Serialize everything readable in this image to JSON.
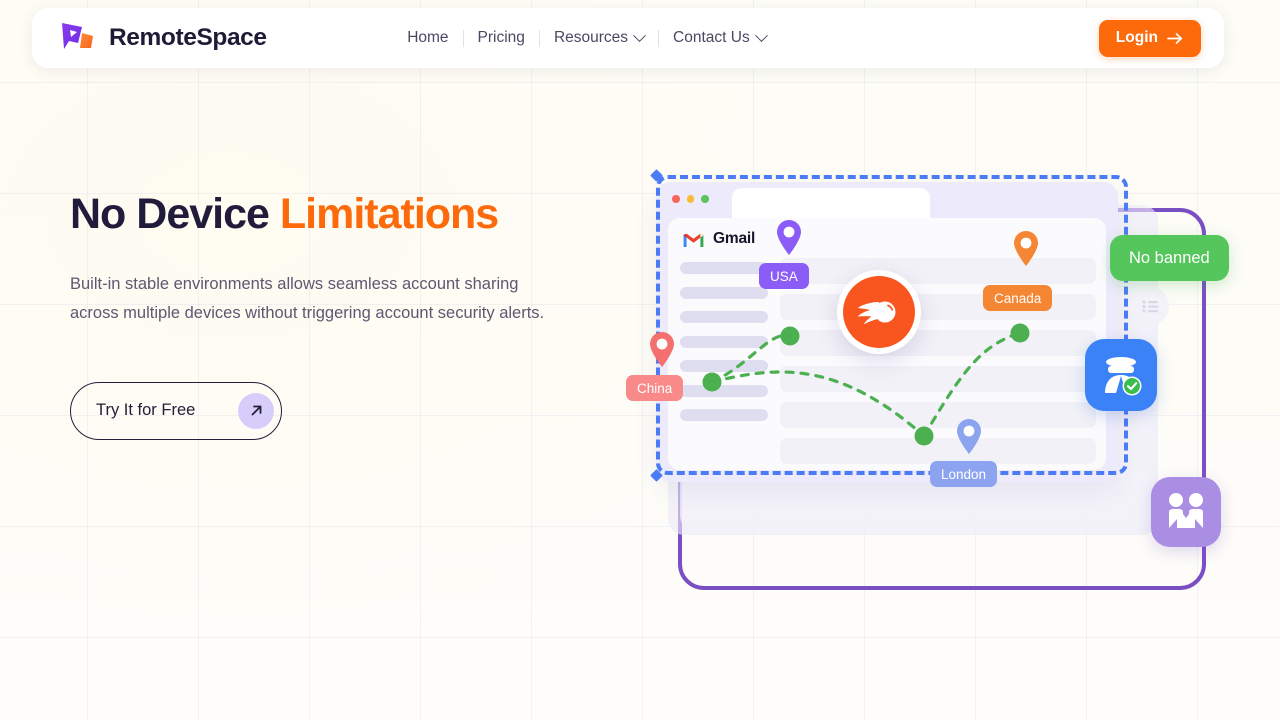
{
  "brand": {
    "name": "RemoteSpace",
    "logo_icon": "cursor-arrow-logo"
  },
  "nav": {
    "items": [
      {
        "label": "Home",
        "has_dropdown": false
      },
      {
        "label": "Pricing",
        "has_dropdown": false
      },
      {
        "label": "Resources",
        "has_dropdown": true
      },
      {
        "label": "Contact Us",
        "has_dropdown": true
      }
    ],
    "login": {
      "label": "Login",
      "icon": "arrow-right-icon",
      "color": "#fc6a0c"
    }
  },
  "hero": {
    "headline_primary": "No Device ",
    "headline_accent": "Limitations",
    "subtitle": "Built-in stable environments allows seamless account sharing across multiple devices without triggering account security alerts.",
    "cta": {
      "label": "Try It for Free",
      "icon": "arrow-up-right-icon"
    }
  },
  "illustration": {
    "app_label": "Gmail",
    "app_icon": "gmail-m-icon",
    "center_icon": "comet-icon",
    "window_dots": [
      "#f9655c",
      "#f6bd3b",
      "#5ac45e"
    ],
    "locations": [
      {
        "label": "USA",
        "color": "#8b5cf6",
        "pin_color": "#8b5cf6"
      },
      {
        "label": "Canada",
        "color": "#f58634",
        "pin_color": "#f58634"
      },
      {
        "label": "China",
        "color": "#f98a8a",
        "pin_color": "#f4706f"
      },
      {
        "label": "London",
        "color": "#8ca4f0",
        "pin_color": "#8ca4f0"
      }
    ],
    "badges": [
      {
        "label": "No banned",
        "color": "#55c65b",
        "icon": "none"
      },
      {
        "label": "",
        "color": "#3b82f6",
        "icon": "incognito-spy-icon"
      },
      {
        "label": "",
        "color": "#a98ee4",
        "icon": "people-handshake-icon"
      }
    ],
    "selection_color": "#4b7bf5",
    "frame_color": "#7b4fc4",
    "network_color": "#4caf50"
  }
}
